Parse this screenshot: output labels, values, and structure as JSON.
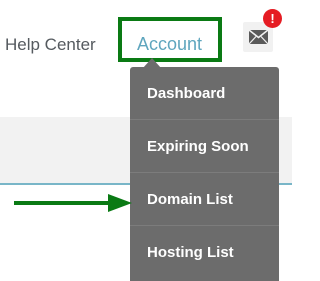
{
  "header": {
    "help_label": "Help Center",
    "account_label": "Account",
    "notification_badge": "!"
  },
  "menu": {
    "items": [
      {
        "label": "Dashboard"
      },
      {
        "label": "Expiring Soon"
      },
      {
        "label": "Domain List"
      },
      {
        "label": "Hosting List"
      }
    ]
  },
  "colors": {
    "highlight": "#0a7a14",
    "account_link": "#5fa6be",
    "menu_bg": "#6c6c6c",
    "badge": "#e51c23",
    "rule": "#79b6c8"
  },
  "icons": {
    "mail": "mail-icon",
    "pointer_arrow": "arrow-right-icon"
  }
}
